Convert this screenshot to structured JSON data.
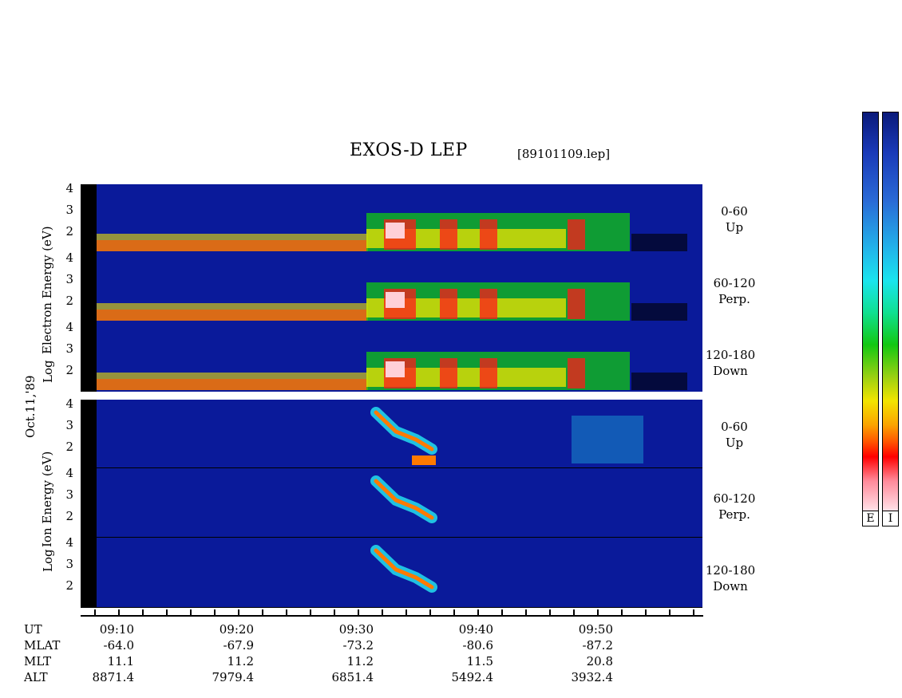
{
  "chart_data": {
    "type": "heatmap",
    "title": "EXOS-D LEP",
    "file_label": "[89101109.lep]",
    "date_label": "Oct.11,'89",
    "electron_axis_label": "Electron Energy (eV)",
    "electron_axis_prefix": "Log",
    "ion_axis_label": "Ion Energy (eV)",
    "ion_axis_prefix": "Log",
    "yticks": [
      "4",
      "3",
      "2"
    ],
    "ylim": [
      1,
      4.2
    ],
    "electron_panels": [
      {
        "line1": "0-60",
        "line2": "Up"
      },
      {
        "line1": "60-120",
        "line2": "Perp."
      },
      {
        "line1": "120-180",
        "line2": "Down"
      }
    ],
    "ion_panels": [
      {
        "line1": "0-60",
        "line2": "Up"
      },
      {
        "line1": "60-120",
        "line2": "Perp."
      },
      {
        "line1": "120-180",
        "line2": "Down"
      }
    ],
    "time_axis": {
      "row_labels": [
        "UT",
        "MLAT",
        "MLT",
        "ALT"
      ],
      "columns": [
        {
          "UT": "09:10",
          "MLAT": "-64.0",
          "MLT": "11.1",
          "ALT": "8871.4"
        },
        {
          "UT": "09:20",
          "MLAT": "-67.9",
          "MLT": "11.2",
          "ALT": "7979.4"
        },
        {
          "UT": "09:30",
          "MLAT": "-73.2",
          "MLT": "11.2",
          "ALT": "6851.4"
        },
        {
          "UT": "09:40",
          "MLAT": "-80.6",
          "MLT": "11.5",
          "ALT": "5492.4"
        },
        {
          "UT": "09:50",
          "MLAT": "-87.2",
          "MLT": "20.8",
          "ALT": "3932.4"
        }
      ]
    },
    "colorbars": [
      {
        "label": "E"
      },
      {
        "label": "I"
      }
    ],
    "colors": {
      "background": "#0a1a9a",
      "low": "#1a3ab8",
      "mid": "#22d4ea",
      "green": "#12c812",
      "yellow": "#f2e400",
      "orange": "#ff7a00",
      "red": "#ff1a1a",
      "pink": "#ffd0d8"
    }
  }
}
